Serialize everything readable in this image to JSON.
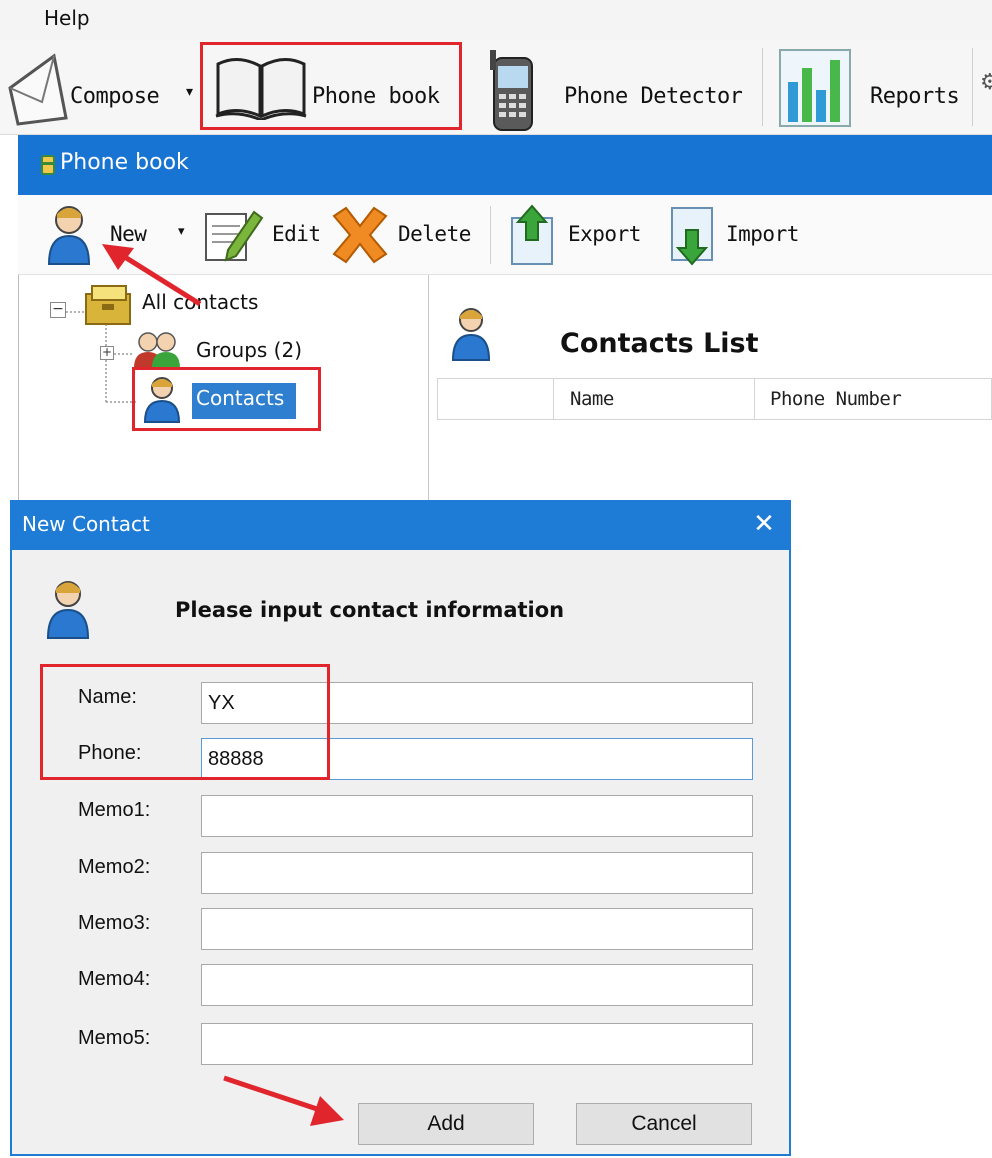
{
  "menu": {
    "help_label": "Help"
  },
  "main_toolbar": {
    "compose_label": "Compose",
    "phonebook_label": "Phone book",
    "detector_label": "Phone Detector",
    "reports_label": "Reports"
  },
  "phonebook_window": {
    "title": "Phone book",
    "toolbar": {
      "new_label": "New",
      "edit_label": "Edit",
      "delete_label": "Delete",
      "export_label": "Export",
      "import_label": "Import"
    },
    "tree": {
      "root_label": "All contacts",
      "groups_label": "Groups (2)",
      "contacts_label": "Contacts"
    },
    "list": {
      "title": "Contacts List",
      "columns": [
        "Name",
        "Phone Number"
      ]
    }
  },
  "dialog": {
    "title": "New Contact",
    "close_glyph": "✕",
    "heading": "Please input contact information",
    "fields": [
      {
        "label": "Name:",
        "value": "YX"
      },
      {
        "label": "Phone:",
        "value": "88888"
      },
      {
        "label": "Memo1:",
        "value": ""
      },
      {
        "label": "Memo2:",
        "value": ""
      },
      {
        "label": "Memo3:",
        "value": ""
      },
      {
        "label": "Memo4:",
        "value": ""
      },
      {
        "label": "Memo5:",
        "value": ""
      }
    ],
    "add_label": "Add",
    "cancel_label": "Cancel"
  },
  "colors": {
    "titlebar_blue": "#1874d2",
    "annotation_red": "#e0262c",
    "selection_blue": "#2f7fd0"
  }
}
